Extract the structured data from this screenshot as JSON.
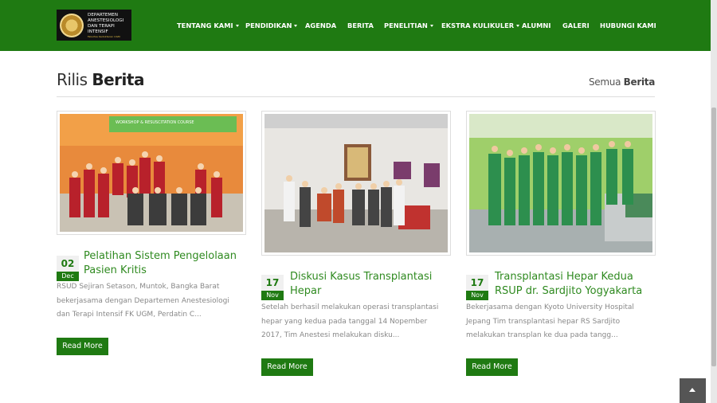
{
  "header": {
    "logo_lines": [
      "DEPARTEMEN",
      "ANESTESIOLOGI",
      "DAN TERAPI INTENSIF"
    ],
    "logo_subtext": "Fakultas Kedokteran UGM",
    "nav": [
      {
        "label": "TENTANG KAMI",
        "dropdown": true
      },
      {
        "label": "PENDIDIKAN",
        "dropdown": true
      },
      {
        "label": "AGENDA",
        "dropdown": false
      },
      {
        "label": "BERITA",
        "dropdown": false
      },
      {
        "label": "PENELITIAN",
        "dropdown": true
      },
      {
        "label": "EKSTRA KULIKULER",
        "dropdown": true
      },
      {
        "label": "ALUMNI",
        "dropdown": false
      },
      {
        "label": "GALERI",
        "dropdown": false
      },
      {
        "label": "HUBUNGI KAMI",
        "dropdown": false
      }
    ]
  },
  "section": {
    "title_light": "Rilis",
    "title_bold": "Berita",
    "all_light": "Semua",
    "all_bold": "Berita"
  },
  "posts": [
    {
      "day": "02",
      "month": "Dec",
      "title": "Pelatihan Sistem Pengelolaan Pasien Kritis",
      "excerpt": "RSUD Sejiran Setason, Muntok, Bangka Barat bekerjasama dengan Departemen Anestesiologi dan Terapi Intensif FK UGM, Perdatin C...",
      "button": "Read More",
      "banner_text": "WORKSHOP & RESUSCITATION COURSE"
    },
    {
      "day": "17",
      "month": "Nov",
      "title": "Diskusi Kasus Transplantasi Hepar",
      "excerpt": "Setelah berhasil melakukan operasi transplantasi hepar yang kedua pada tanggal 14 Nopember 2017, Tim Anestesi melakukan disku...",
      "button": "Read More"
    },
    {
      "day": "17",
      "month": "Nov",
      "title": "Transplantasi Hepar Kedua RSUP dr. Sardjito Yogyakarta",
      "excerpt": "Bekerjasama dengan Kyoto University Hospital Jepang Tim transplantasi hepar RS Sardjito melakukan transplan ke dua pada tangg...",
      "button": "Read More"
    }
  ],
  "colors": {
    "brand_green": "#1f7a12",
    "link_green": "#2f8a20",
    "text_gray": "#888888"
  },
  "icons": {
    "back_to_top": "chevron-up-icon",
    "dropdown": "caret-down-icon"
  }
}
